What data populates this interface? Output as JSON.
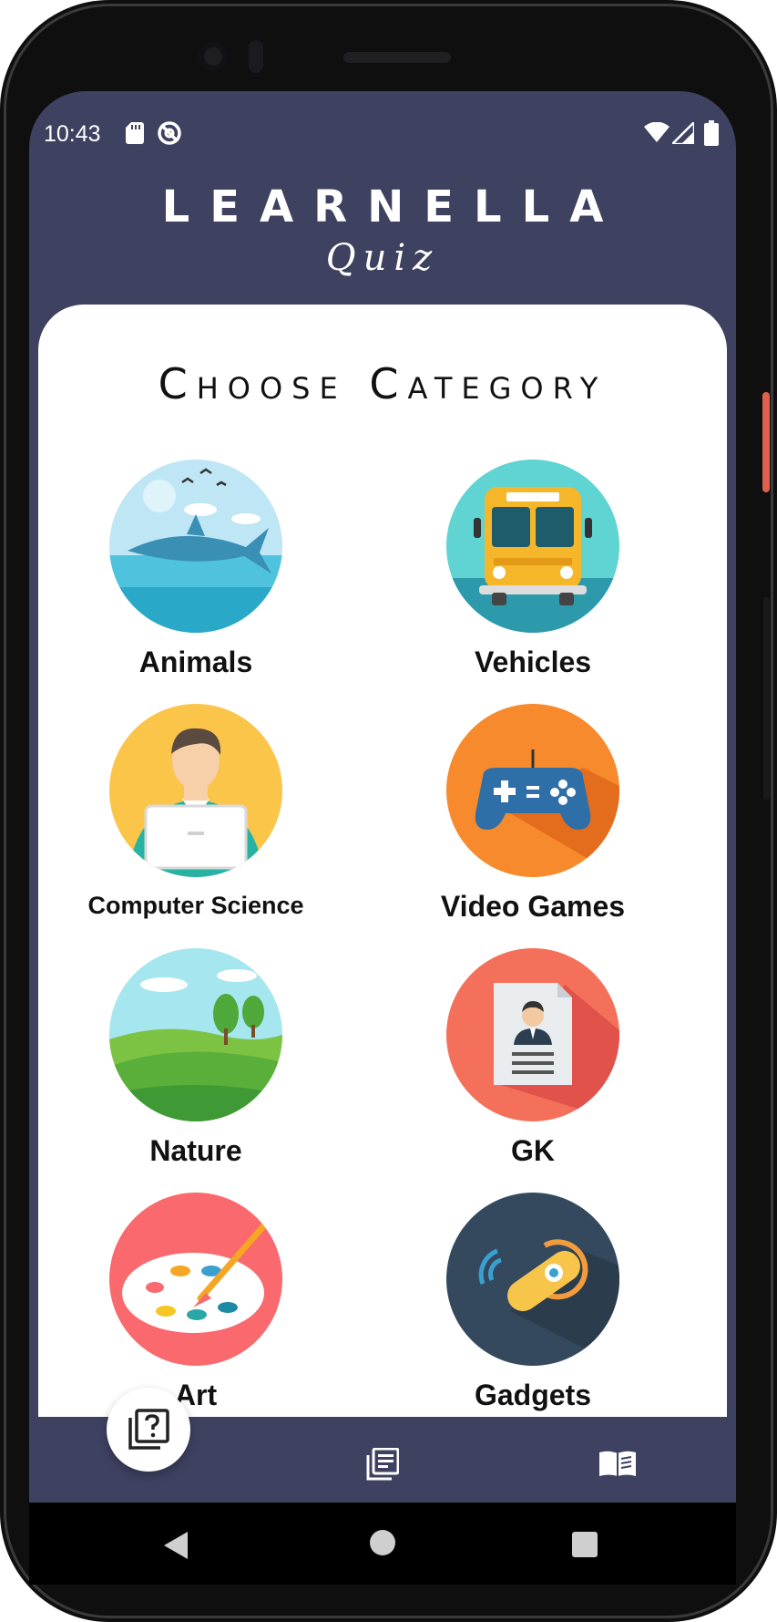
{
  "status_bar": {
    "time": "10:43",
    "icons": [
      "sd-card-icon",
      "sync-icon",
      "wifi-icon",
      "signal-icon",
      "battery-icon"
    ]
  },
  "brand": {
    "name": "LEARNELLA",
    "subtitle": "Quiz"
  },
  "main": {
    "title": "Choose Category",
    "categories": [
      {
        "label": "Animals",
        "icon": "shark-icon"
      },
      {
        "label": "Vehicles",
        "icon": "school-bus-icon"
      },
      {
        "label": "Computer Science",
        "icon": "programmer-icon"
      },
      {
        "label": "Video Games",
        "icon": "gamepad-icon"
      },
      {
        "label": "Nature",
        "icon": "landscape-icon"
      },
      {
        "label": "GK",
        "icon": "id-document-icon"
      },
      {
        "label": "Art",
        "icon": "paint-palette-icon"
      },
      {
        "label": "Gadgets",
        "icon": "bluetooth-headset-icon"
      }
    ]
  },
  "bottom_nav": {
    "items": [
      "quiz-icon",
      "articles-icon",
      "book-icon"
    ],
    "active": "quiz-icon"
  },
  "colors": {
    "primary": "#3e4160",
    "background": "#ffffff",
    "text": "#111111"
  }
}
